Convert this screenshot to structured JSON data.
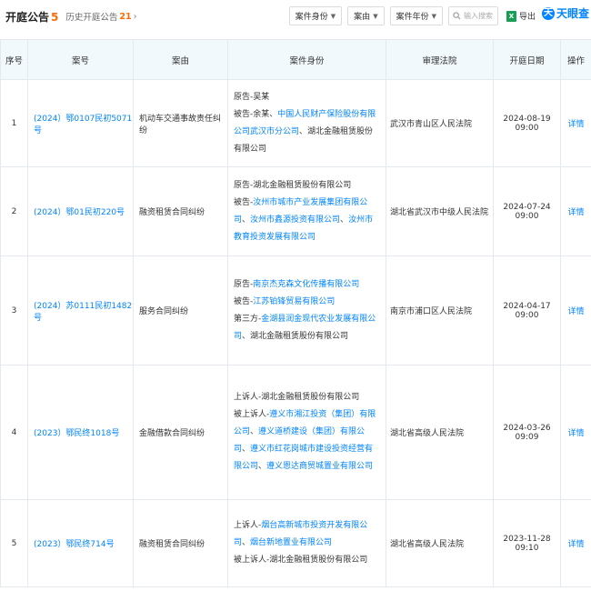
{
  "header": {
    "title": "开庭公告",
    "count": "5",
    "history_label": "历史开庭公告",
    "history_count": "21",
    "history_arrow": "›"
  },
  "filters": {
    "role": "案件身份",
    "reason": "案由",
    "year": "案件年份",
    "search_placeholder": "输入搜索",
    "export": "导出"
  },
  "brand": {
    "logo_text": "天眼查",
    "logo_mark": "天"
  },
  "table": {
    "headers": [
      "序号",
      "案号",
      "案由",
      "案件身份",
      "审理法院",
      "开庭日期",
      "操作"
    ],
    "rows": [
      {
        "index": "1",
        "case_no": "(2024）鄂0107民初5071号",
        "reason": "机动车交通事故责任纠纷",
        "roles": [
          [
            {
              "t": "原告-吴某",
              "l": false
            }
          ],
          [
            {
              "t": "被告-余某、",
              "l": false
            },
            {
              "t": "中国人民财产保险股份有限公司武汉市分公司",
              "l": true
            },
            {
              "t": "、湖北金融租赁股份有限公司",
              "l": false
            }
          ]
        ],
        "court": "武汉市青山区人民法院",
        "date": "2024-08-19 09:00",
        "action": "详情"
      },
      {
        "index": "2",
        "case_no": "(2024）鄂01民初220号",
        "reason": "融资租赁合同纠纷",
        "roles": [
          [
            {
              "t": "原告-湖北金融租赁股份有限公司",
              "l": false
            }
          ],
          [
            {
              "t": "被告-",
              "l": false
            },
            {
              "t": "汝州市城市产业发展集团有限公司",
              "l": true
            },
            {
              "t": "、",
              "l": false
            },
            {
              "t": "汝州市鑫源投资有限公司",
              "l": true
            },
            {
              "t": "、",
              "l": false
            },
            {
              "t": "汝州市教育投资发展有限公司",
              "l": true
            }
          ]
        ],
        "court": "湖北省武汉市中级人民法院",
        "date": "2024-07-24 09:00",
        "action": "详情"
      },
      {
        "index": "3",
        "case_no": "(2024）苏0111民初1482号",
        "reason": "服务合同纠纷",
        "roles": [
          [
            {
              "t": "原告-",
              "l": false
            },
            {
              "t": "南京杰克森文化传播有限公司",
              "l": true
            }
          ],
          [
            {
              "t": "被告-",
              "l": false
            },
            {
              "t": "江苏铂锋贸易有限公司",
              "l": true
            }
          ],
          [
            {
              "t": "第三方-",
              "l": false
            },
            {
              "t": "金湖县润金现代农业发展有限公司",
              "l": true
            },
            {
              "t": "、湖北金融租赁股份有限公司",
              "l": false
            }
          ]
        ],
        "court": "南京市浦口区人民法院",
        "date": "2024-04-17 09:00",
        "action": "详情"
      },
      {
        "index": "4",
        "case_no": "(2023）鄂民终1018号",
        "reason": "金融借款合同纠纷",
        "roles": [
          [
            {
              "t": "上诉人-湖北金融租赁股份有限公司",
              "l": false
            }
          ],
          [
            {
              "t": "被上诉人-",
              "l": false
            },
            {
              "t": "遵义市湘江投资（集团）有限公司",
              "l": true
            },
            {
              "t": "、",
              "l": false
            },
            {
              "t": "遵义道桥建设（集团）有限公司",
              "l": true
            },
            {
              "t": "、",
              "l": false
            },
            {
              "t": "遵义市红花岗城市建设投资经营有限公司",
              "l": true
            },
            {
              "t": "、",
              "l": false
            },
            {
              "t": "遵义恩达商贸城置业有限公司",
              "l": true
            }
          ]
        ],
        "court": "湖北省高级人民法院",
        "date": "2024-03-26 09:09",
        "action": "详情"
      },
      {
        "index": "5",
        "case_no": "(2023）鄂民终714号",
        "reason": "融资租赁合同纠纷",
        "roles": [
          [
            {
              "t": "上诉人-",
              "l": false
            },
            {
              "t": "烟台高新城市投资开发有限公司",
              "l": true
            },
            {
              "t": "、",
              "l": false
            },
            {
              "t": "烟台新地置业有限公司",
              "l": true
            }
          ],
          [
            {
              "t": "被上诉人-湖北金融租赁股份有限公司",
              "l": false
            }
          ]
        ],
        "court": "湖北省高级人民法院",
        "date": "2023-11-28 09:10",
        "action": "详情"
      }
    ]
  }
}
